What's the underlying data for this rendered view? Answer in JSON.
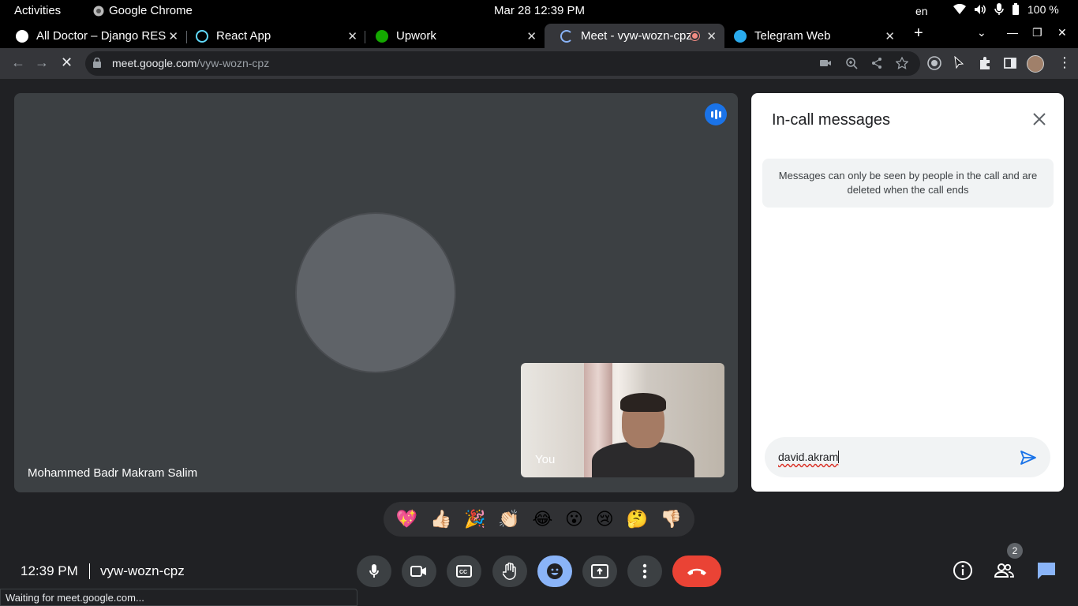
{
  "system_bar": {
    "activities": "Activities",
    "app_name": "Google Chrome",
    "clock": "Mar 28  12:39 PM",
    "language": "en",
    "battery": "100 %"
  },
  "tabs": [
    {
      "label": "All Doctor – Django RES",
      "favicon_color": "#ffffff",
      "active": false
    },
    {
      "label": "React App",
      "favicon_color": "#61dafb",
      "active": false
    },
    {
      "label": "Upwork",
      "favicon_color": "#14a800",
      "active": false
    },
    {
      "label": "Meet - vyw-wozn-cpz",
      "favicon_color": "#8ab4f8",
      "active": true
    },
    {
      "label": "Telegram Web",
      "favicon_color": "#2aabee",
      "active": false
    }
  ],
  "address_bar": {
    "host": "meet.google.com",
    "path": "/vyw-wozn-cpz"
  },
  "meeting": {
    "participant_name": "Mohammed Badr Makram Salim",
    "self_label": "You",
    "time": "12:39 PM",
    "code": "vyw-wozn-cpz",
    "participants_count": "2"
  },
  "chat_panel": {
    "title": "In-call messages",
    "notice": "Messages can only be seen by people in the call and are deleted when the call ends",
    "input_value": "david.akram"
  },
  "reactions": [
    "💖",
    "👍🏻",
    "🎉",
    "👏🏻",
    "😂",
    "😮",
    "😢",
    "🤔",
    "👎🏻"
  ],
  "status_bar": {
    "text": "Waiting for meet.google.com..."
  },
  "colors": {
    "meet_bg": "#202124",
    "tile_bg": "#3c4043",
    "accent_blue": "#8ab4f8",
    "end_call_red": "#ea4335"
  }
}
